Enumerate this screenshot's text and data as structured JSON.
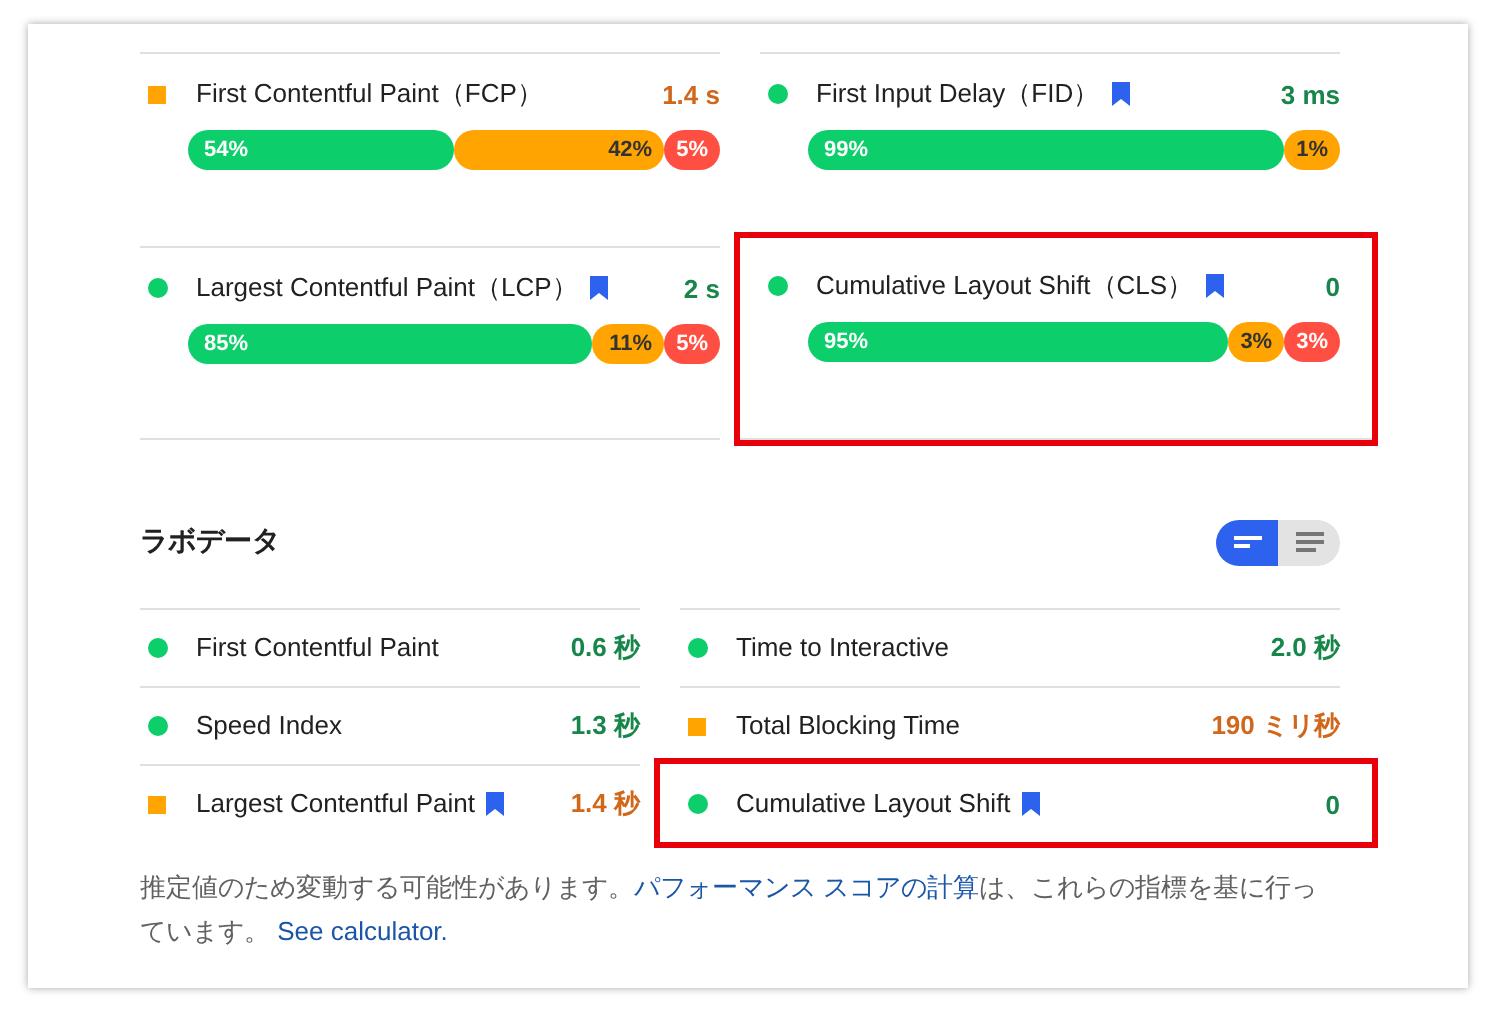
{
  "field": {
    "metrics": [
      {
        "name": "First Contentful Paint（FCP）",
        "color": "#ffa400",
        "value": "1.4 s",
        "bookmark": false,
        "highlighted": false,
        "segments": [
          {
            "label": "54%",
            "color": "#0cce6b"
          },
          {
            "label": "42%",
            "color": "#ffa400"
          },
          {
            "label": "5%",
            "color": "#ff4e42"
          }
        ]
      },
      {
        "name": "First Input Delay（FID）",
        "color": "#0cce6b",
        "value": "3 ms",
        "bookmark": true,
        "highlighted": false,
        "segments": [
          {
            "label": "99%",
            "color": "#0cce6b"
          },
          {
            "label": "1%",
            "color": "#ffa400"
          }
        ]
      },
      {
        "name": "Largest Contentful Paint（LCP）",
        "color": "#0cce6b",
        "value": "2 s",
        "bookmark": true,
        "highlighted": false,
        "segments": [
          {
            "label": "85%",
            "color": "#0cce6b"
          },
          {
            "label": "11%",
            "color": "#ffa400"
          },
          {
            "label": "5%",
            "color": "#ff4e42"
          }
        ]
      },
      {
        "name": "Cumulative Layout Shift（CLS）",
        "color": "#0cce6b",
        "value": "0",
        "bookmark": true,
        "highlighted": true,
        "segments": [
          {
            "label": "95%",
            "color": "#0cce6b"
          },
          {
            "label": "3%",
            "color": "#ffa400"
          },
          {
            "label": "3%",
            "color": "#ff4e42"
          }
        ]
      }
    ]
  },
  "lab": {
    "title": "ラボデータ",
    "view_toggle": [
      {
        "selected": true
      },
      {
        "selected": false
      }
    ],
    "metrics": [
      {
        "name": "First Contentful Paint",
        "color": "#0cce6b",
        "value": "0.6 秒",
        "bookmark": false,
        "highlighted": false
      },
      {
        "name": "Time to Interactive",
        "color": "#0cce6b",
        "value": "2.0 秒",
        "bookmark": false,
        "highlighted": false
      },
      {
        "name": "Speed Index",
        "color": "#0cce6b",
        "value": "1.3 秒",
        "bookmark": false,
        "highlighted": false
      },
      {
        "name": "Total Blocking Time",
        "color": "#ffa400",
        "value": "190 ミリ秒",
        "bookmark": false,
        "highlighted": false
      },
      {
        "name": "Largest Contentful Paint",
        "color": "#ffa400",
        "value": "1.4 秒",
        "bookmark": true,
        "highlighted": false
      },
      {
        "name": "Cumulative Layout Shift",
        "color": "#0cce6b",
        "value": "0",
        "bookmark": true,
        "highlighted": true
      }
    ],
    "note": [
      {
        "kind": "text",
        "text": "推定値のため変動する可能性があります。"
      },
      {
        "kind": "link",
        "text": "パフォーマンス スコアの計算"
      },
      {
        "kind": "text",
        "text": "は、これらの指標を基に行っています。 "
      },
      {
        "kind": "link",
        "text": "See calculator."
      }
    ]
  }
}
